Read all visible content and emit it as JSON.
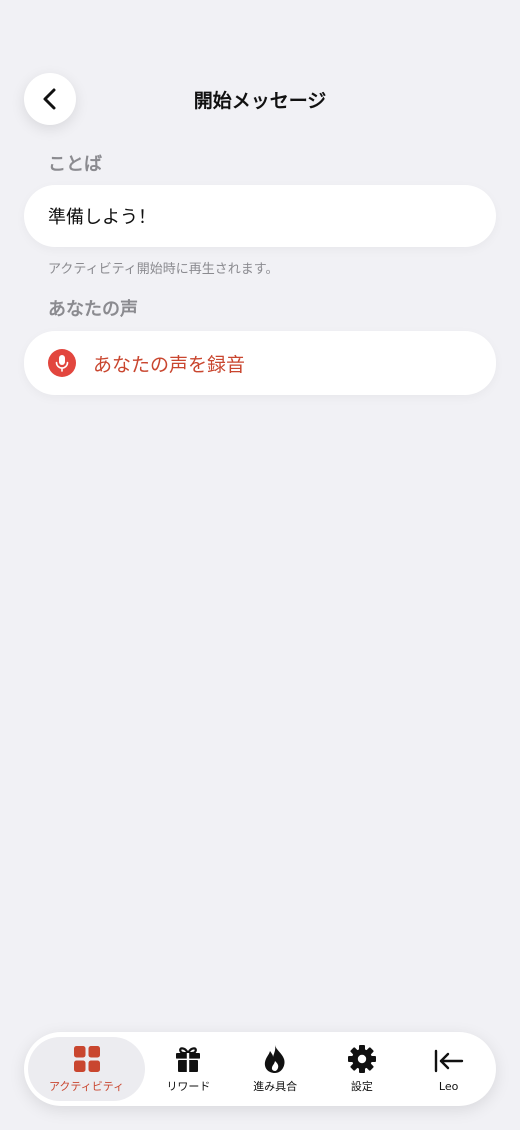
{
  "header": {
    "title": "開始メッセージ"
  },
  "words_section": {
    "label": "ことば",
    "value": "準備しよう！",
    "hint": "アクティビティ開始時に再生されます。"
  },
  "voice_section": {
    "label": "あなたの声",
    "record_label": "あなたの声を録音"
  },
  "tabbar": {
    "items": [
      {
        "label": "アクティビティ",
        "icon": "grid-icon",
        "active": true
      },
      {
        "label": "リワード",
        "icon": "gift-icon",
        "active": false
      },
      {
        "label": "進み具合",
        "icon": "flame-icon",
        "active": false
      },
      {
        "label": "設定",
        "icon": "gear-icon",
        "active": false
      },
      {
        "label": "Leo",
        "icon": "exit-arrow-icon",
        "active": false
      }
    ]
  },
  "colors": {
    "accent": "#c9462f",
    "mic": "#e2463e",
    "background": "#f1f1f5"
  }
}
